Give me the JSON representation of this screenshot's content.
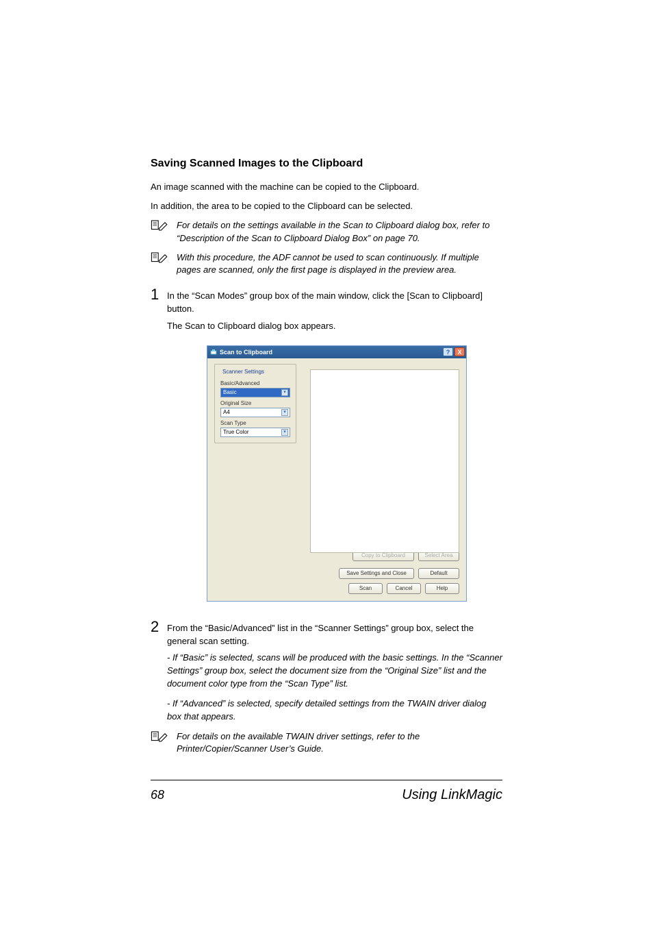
{
  "heading": "Saving Scanned Images to the Clipboard",
  "p1": "An image scanned with the machine can be copied to the Clipboard.",
  "p2": "In addition, the area to be copied to the Clipboard can be selected.",
  "note1": "For details on the settings available in the Scan to Clipboard dialog box, refer to “Description of the Scan to Clipboard Dialog Box” on page 70.",
  "note2": "With this procedure, the ADF cannot be used to scan continuously. If multiple pages are scanned, only the first page is displayed in the preview area.",
  "steps": {
    "s1": {
      "num": "1",
      "text": "In the “Scan Modes” group box of the main window, click the [Scan to Clipboard] button.",
      "sub": "The Scan to Clipboard dialog box appears."
    },
    "s2": {
      "num": "2",
      "text": "From the “Basic/Advanced” list in the “Scanner Settings” group box, select the general scan setting.",
      "res1": "- If “Basic” is selected, scans will be produced with the basic settings. In the “Scanner Settings” group box, select the document size from the “Original Size” list and the document color type from the “Scan Type” list.",
      "res2": "- If “Advanced” is selected, specify detailed settings from the TWAIN driver dialog box that appears."
    }
  },
  "note3": "For details on the available TWAIN driver settings, refer to the Printer/Copier/Scanner User’s Guide.",
  "dialog": {
    "title": "Scan to Clipboard",
    "group": "Scanner Settings",
    "labels": {
      "basicadv": "Basic/Advanced",
      "origsize": "Original Size",
      "scantype": "Scan Type"
    },
    "values": {
      "basicadv": "Basic",
      "origsize": "A4",
      "scantype": "True Color"
    },
    "buttons": {
      "copy": "Copy to Clipboard",
      "selectarea": "Select Area",
      "saveclose": "Save Settings and Close",
      "default": "Default",
      "scan": "Scan",
      "cancel": "Cancel",
      "help": "Help"
    },
    "ctrl": {
      "help": "?",
      "close": "X"
    }
  },
  "footer": {
    "page": "68",
    "section": "Using LinkMagic"
  }
}
